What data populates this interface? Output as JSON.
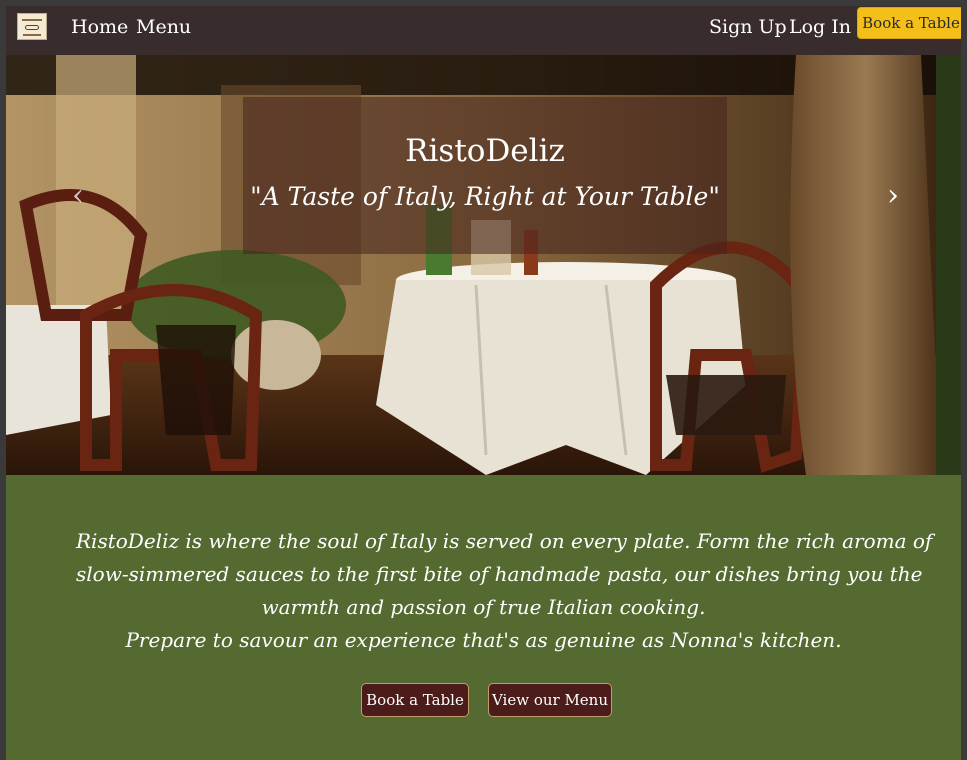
{
  "navbar": {
    "logo_icon": "restaurant-logo-icon",
    "home_label": "Home",
    "menu_label": "Menu",
    "signup_label": "Sign Up",
    "login_label": "Log In",
    "book_label": "Book a Table",
    "book_color": "#f4bf19"
  },
  "hero": {
    "title": "RistoDeliz",
    "tagline": "\"A Taste of Italy, Right at Your Table\"",
    "prev_icon": "‹",
    "next_icon": "›"
  },
  "intro": {
    "lines": [
      "RistoDeliz is where the soul of Italy is served on every plate. Form the rich aroma of",
      "slow-simmered sauces to the first bite of handmade pasta, our dishes bring you the",
      "warmth and passion of true Italian cooking.",
      "Prepare to savour an experience that's as genuine as Nonna's kitchen."
    ],
    "book_button_label": "Book a Table",
    "menu_button_label": "View our Menu",
    "background_color": "#546a30"
  }
}
